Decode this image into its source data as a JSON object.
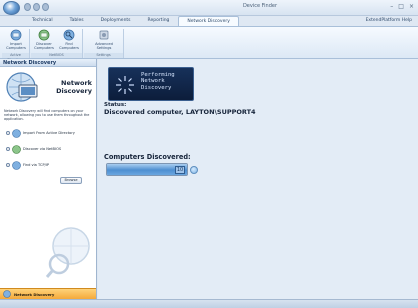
{
  "window": {
    "title": "Device Finder",
    "controls": {
      "minimize": "–",
      "maximize": "□",
      "close": "×"
    }
  },
  "tabs": [
    {
      "label": "Technical"
    },
    {
      "label": "Tables"
    },
    {
      "label": "Deployments"
    },
    {
      "label": "Reporting"
    },
    {
      "label": "Network Discovery",
      "active": true
    }
  ],
  "help_link": "ExtendPlatform Help",
  "ribbon": {
    "groups": [
      {
        "label": "Active Directory",
        "buttons": [
          {
            "label": "Import Computers",
            "icon": "import-computers-icon"
          }
        ]
      },
      {
        "label": "NetBIOS",
        "buttons": [
          {
            "label": "Discover Computers",
            "icon": "discover-computers-icon"
          },
          {
            "label": "Find Computers",
            "icon": "find-computers-icon"
          }
        ]
      },
      {
        "label": "Settings",
        "buttons": [
          {
            "label": "Advanced Settings",
            "icon": "advanced-settings-icon"
          }
        ]
      }
    ]
  },
  "left_pane": {
    "header": "Network Discovery",
    "hero_title_line1": "Network",
    "hero_title_line2": "Discovery",
    "description": "Network Discovery will find computers on your network, allowing you to use them throughout the application.",
    "options": [
      {
        "label": "Import From Active Directory"
      },
      {
        "label": "Discover via NetBIOS"
      },
      {
        "label": "Find via TCP/IP"
      }
    ],
    "browse_button": "Browse",
    "footer_label": "Network Discovery"
  },
  "main": {
    "banner_line1": "Performing",
    "banner_line2": "Network",
    "banner_line3": "Discovery",
    "status_label": "Status:",
    "status_text": "Discovered computer, LAYTON\\SUPPORT4",
    "computers_label": "Computers Discovered:",
    "computers_count": "10",
    "progress_fraction": 1.0
  },
  "colors": {
    "accent": "#4e8fd1",
    "footer_orange": "#f5a93a",
    "banner_bg": "#0c1d3b"
  }
}
